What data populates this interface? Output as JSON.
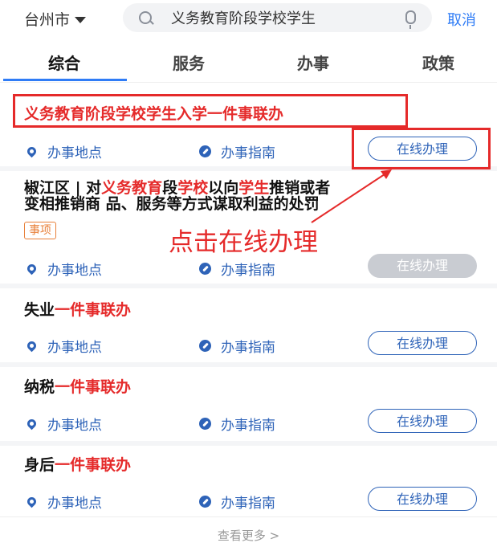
{
  "header": {
    "city": "台州市",
    "search_value": "义务教育阶段学校学生",
    "cancel": "取消"
  },
  "tabs": [
    {
      "label": "综合",
      "active": true
    },
    {
      "label": "服务"
    },
    {
      "label": "办事"
    },
    {
      "label": "政策"
    }
  ],
  "results": [
    {
      "title": "义务教育阶段学校学生入学一件事联办",
      "location": "办事地点",
      "guide": "办事指南",
      "action": "在线办理"
    },
    {
      "title_line1_a": "椒江区 | 对",
      "title_line1_b": "义务教育",
      "title_line1_c": "段",
      "title_line1_d": "学校",
      "title_line1_e": "以向",
      "title_line1_f": "学生",
      "title_line1_g": "推销或者",
      "title_line2": "变相推销商 品、服务等方式谋取利益的处罚",
      "tag": "事项",
      "location": "办事地点",
      "guide": "办事指南",
      "action": "在线办理",
      "action_disabled": true
    },
    {
      "title_a": "失业",
      "title_b": "一件事联办",
      "location": "办事地点",
      "guide": "办事指南",
      "action": "在线办理"
    },
    {
      "title_a": "纳税",
      "title_b": "一件事联办",
      "location": "办事地点",
      "guide": "办事指南",
      "action": "在线办理"
    },
    {
      "title_a": "身后",
      "title_b": "一件事联办",
      "location": "办事地点",
      "guide": "办事指南",
      "action": "在线办理"
    }
  ],
  "annotation": "点击在线办理",
  "more": "查看更多 >",
  "colors": {
    "accent": "#2f7cf6",
    "highlight": "#e52a2a",
    "link": "#2e63b8"
  }
}
